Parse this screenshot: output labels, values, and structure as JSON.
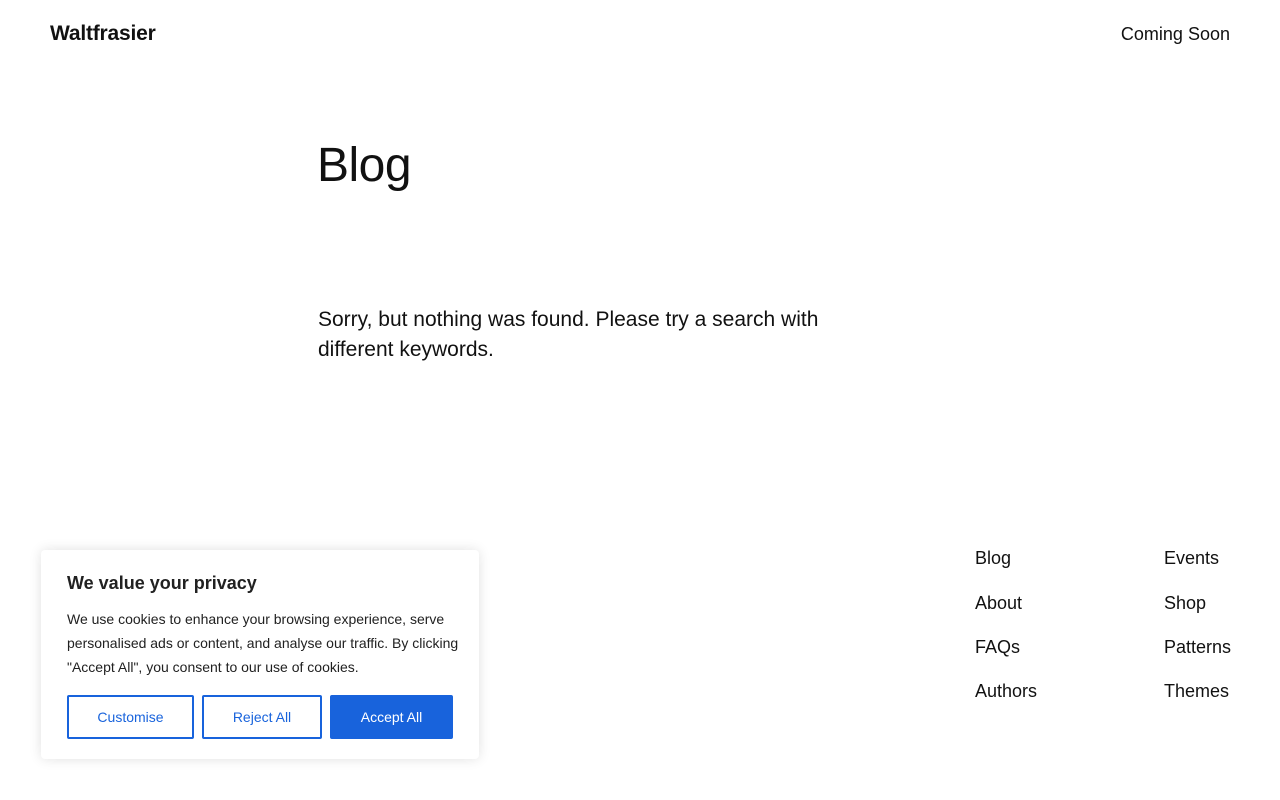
{
  "header": {
    "site_title": "Waltfrasier",
    "nav_link": "Coming Soon"
  },
  "main": {
    "page_title": "Blog",
    "empty_message": "Sorry, but nothing was found. Please try a search with different keywords."
  },
  "footer": {
    "links": [
      {
        "label": "Blog"
      },
      {
        "label": "About"
      },
      {
        "label": "FAQs"
      },
      {
        "label": "Authors"
      },
      {
        "label": "Events"
      },
      {
        "label": "Shop"
      },
      {
        "label": "Patterns"
      },
      {
        "label": "Themes"
      }
    ]
  },
  "cookie_banner": {
    "title": "We value your privacy",
    "text": "We use cookies to enhance your browsing experience, serve personalised ads or content, and analyse our traffic. By clicking \"Accept All\", you consent to our use of cookies.",
    "customise_label": "Customise",
    "reject_label": "Reject All",
    "accept_label": "Accept All"
  },
  "colors": {
    "accent": "#1863dc",
    "text": "#111111",
    "background": "#ffffff"
  }
}
